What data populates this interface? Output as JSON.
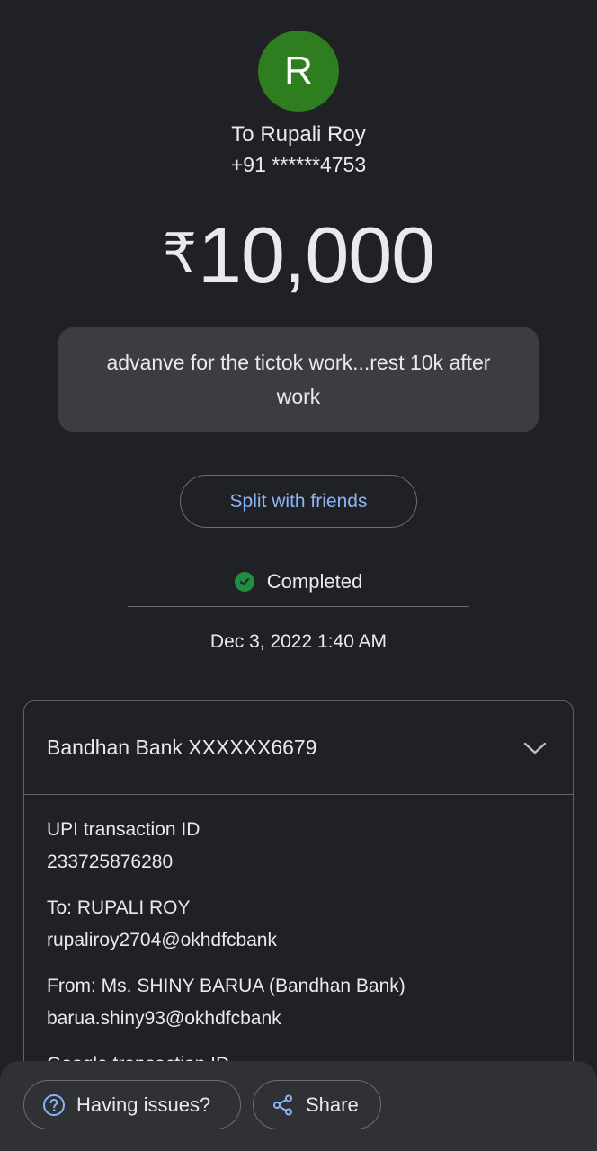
{
  "recipient": {
    "initial": "R",
    "avatar_color": "#2e7d1f",
    "title": "To Rupali Roy",
    "phone": "+91 ******4753"
  },
  "payment": {
    "currency_symbol": "₹",
    "amount": "10,000",
    "note": "advanve for the tictok work...rest 10k after work"
  },
  "actions": {
    "split_label": "Split with friends"
  },
  "status": {
    "label": "Completed",
    "icon": "check-circle-icon",
    "color": "#1e8e3e",
    "datetime": "Dec 3, 2022 1:40 AM"
  },
  "details": {
    "account": "Bandhan Bank XXXXXX6679",
    "expand_icon": "chevron-down-icon",
    "fields": [
      {
        "label": "UPI transaction ID",
        "value": "233725876280"
      },
      {
        "label": "To: RUPALI ROY",
        "value": "rupaliroy2704@okhdfcbank"
      },
      {
        "label": "From: Ms. SHINY BARUA (Bandhan Bank)",
        "value": "barua.shiny93@okhdfcbank"
      },
      {
        "label": "Google transaction ID",
        "value": ""
      }
    ]
  },
  "bottom_bar": {
    "issues_label": "Having issues?",
    "issues_icon": "help-circle-icon",
    "share_label": "Share",
    "share_icon": "share-icon"
  },
  "colors": {
    "background": "#202124",
    "accent_link": "#8ab4f8"
  }
}
